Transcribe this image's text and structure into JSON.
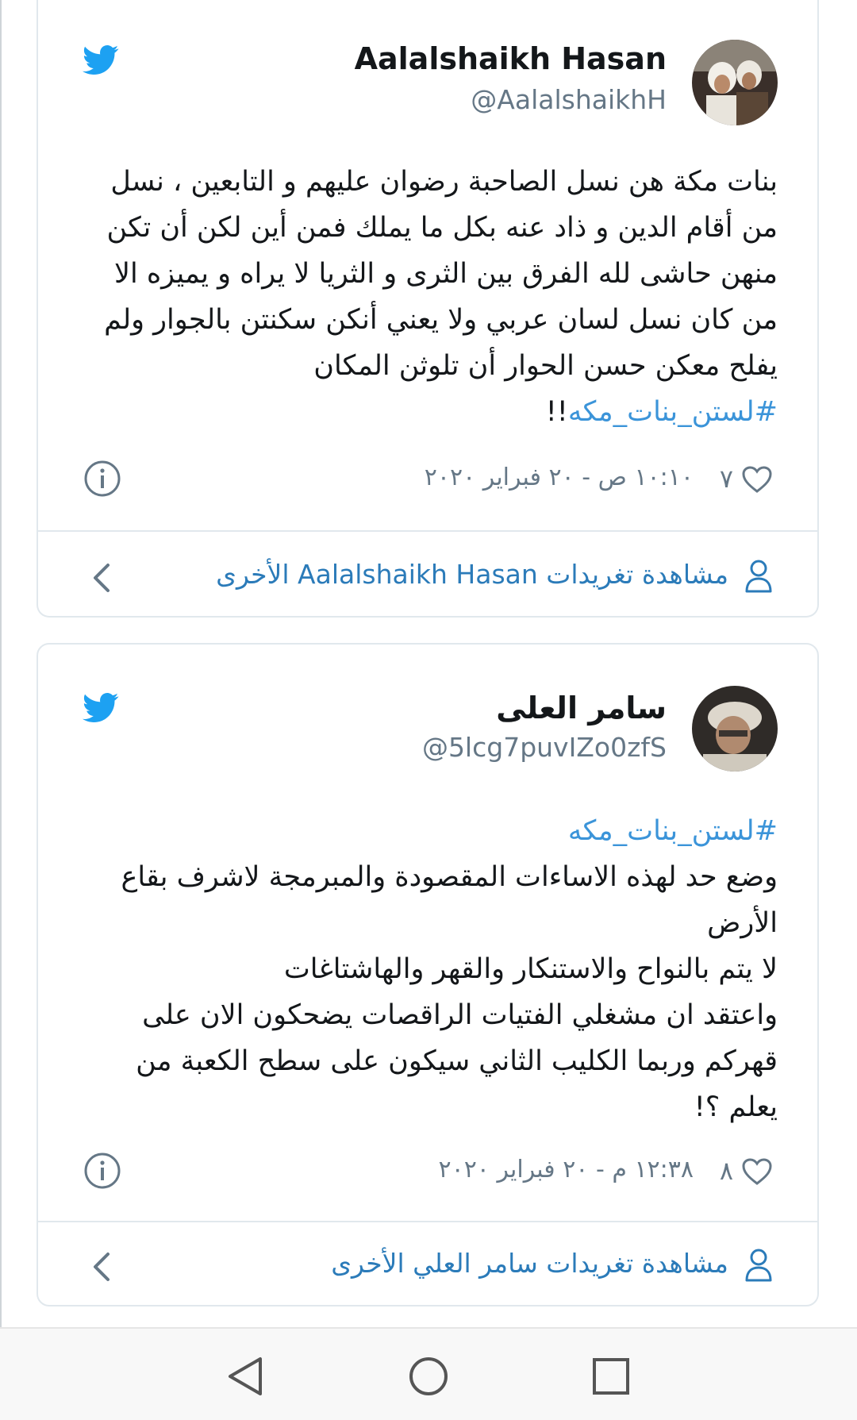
{
  "tweets": [
    {
      "name": "Aalalshaikh Hasan",
      "handle": "@AalalshaikhH",
      "body_lines": [
        "بنات مكة هن نسل الصاحبة رضوان عليهم و التابعين ، نسل",
        "من أقام الدين و ذاد عنه بكل ما يملك فمن أين لكن أن تكن",
        "منهن حاشى لله الفرق بين الثرى و الثريا لا يراه و يميزه الا",
        "من كان نسل لسان عربي ولا يعني أنكن سكنتن بالجوار ولم",
        "يفلح معكن حسن الحوار أن تلوثن المكان"
      ],
      "hashtag_line_prefix": "!!",
      "hashtag": "#لستن_بنات_مكه",
      "likes": "٧",
      "timestamp": "١٠:١٠ ص - ٢٠ فبراير ٢٠٢٠",
      "more_label": "مشاهدة تغريدات Aalalshaikh Hasan الأخرى"
    },
    {
      "name": "سامر العلى",
      "handle": "@5lcg7puvIZo0zfS",
      "hashtag": "#لستن_بنات_مكه",
      "body_lines": [
        "وضع حد لهذه الاساءات المقصودة والمبرمجة لاشرف بقاع",
        "الأرض",
        "لا يتم بالنواح والاستنكار والقهر والهاشتاغات",
        "واعتقد ان مشغلي الفتيات الراقصات يضحكون الان على",
        "قهركم وربما الكليب الثاني سيكون على سطح الكعبة من",
        "يعلم ؟!"
      ],
      "likes": "٨",
      "timestamp": "١٢:٣٨ م - ٢٠ فبراير ٢٠٢٠",
      "more_label": "مشاهدة تغريدات سامر العلي الأخرى"
    }
  ],
  "icons": {
    "twitter": "twitter-bird-icon",
    "info": "info-icon",
    "heart": "heart-icon",
    "user": "user-icon",
    "chevron": "chevron-left-icon",
    "nav_back": "back-triangle-icon",
    "nav_home": "home-circle-icon",
    "nav_recents": "recents-square-icon"
  },
  "colors": {
    "twitter_blue": "#1da1f2",
    "link": "#2b7bb9",
    "muted": "#657786"
  }
}
